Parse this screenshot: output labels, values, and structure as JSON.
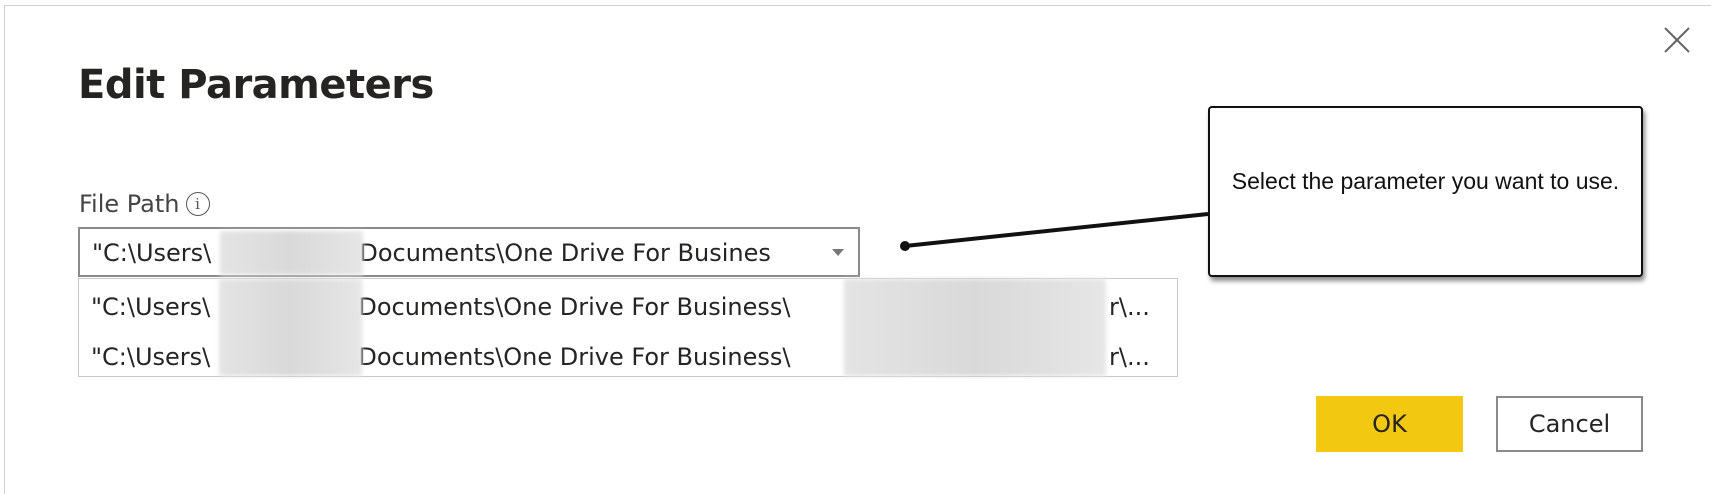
{
  "dialog": {
    "title": "Edit Parameters",
    "close_icon": "close-icon"
  },
  "parameter": {
    "label": "File Path",
    "info_icon": "i",
    "selected_value": "\"C:\\Users\\",
    "selected_value_rest": "\\Documents\\One Drive For Busines",
    "options": [
      {
        "prefix": "\"C:\\Users\\",
        "middle": "\\Documents\\One Drive For Business\\",
        "suffix": "r\\..."
      },
      {
        "prefix": "\"C:\\Users\\",
        "middle": "\\Documents\\One Drive For Business\\",
        "suffix": "r\\..."
      }
    ]
  },
  "callout": {
    "text": "Select the parameter you want to use."
  },
  "buttons": {
    "ok": "OK",
    "cancel": "Cancel"
  },
  "colors": {
    "primary_button": "#f2c811"
  }
}
